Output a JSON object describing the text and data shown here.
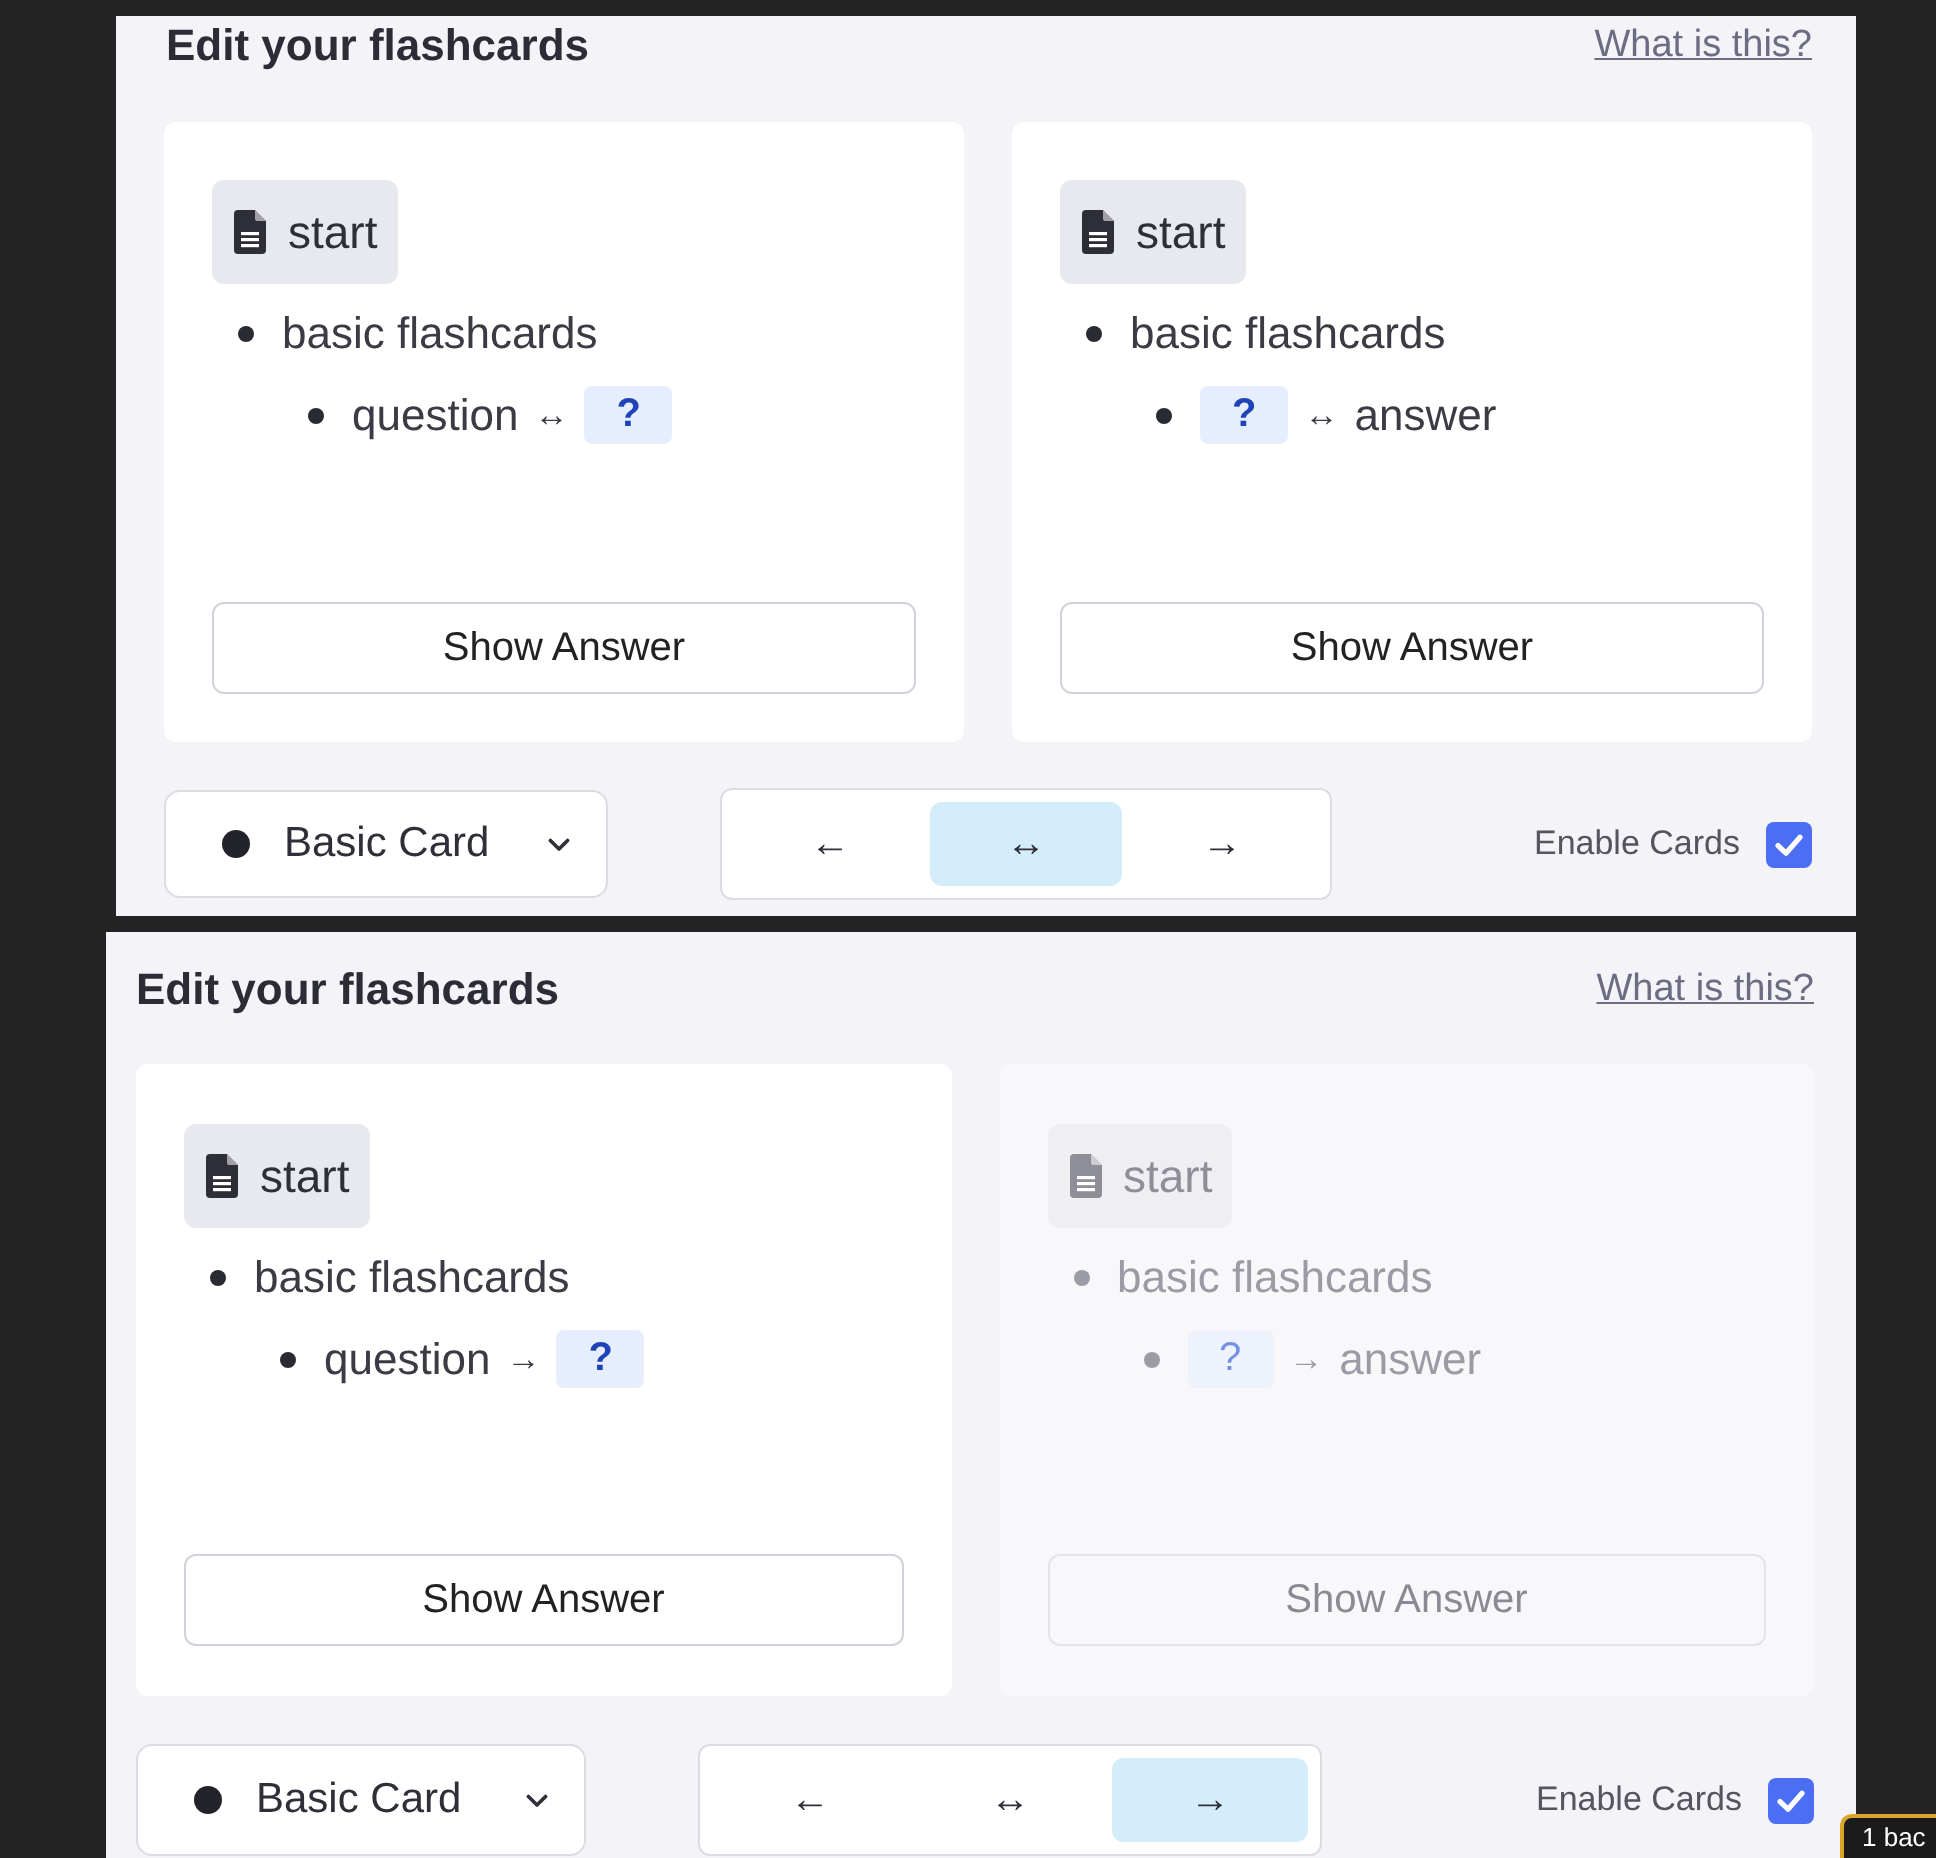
{
  "panels": [
    {
      "title": "Edit your flashcards",
      "help_link": "What is this?",
      "cards": [
        {
          "disabled": false,
          "heading": "start",
          "items": [
            {
              "parts": [
                {
                  "kind": "text",
                  "text": "basic flashcards"
                }
              ],
              "children": [
                {
                  "parts": [
                    {
                      "kind": "text",
                      "text": "question"
                    },
                    {
                      "kind": "arrow",
                      "text": "↔"
                    },
                    {
                      "kind": "blank",
                      "text": "?"
                    }
                  ]
                }
              ]
            }
          ],
          "button": "Show Answer"
        },
        {
          "disabled": false,
          "heading": "start",
          "items": [
            {
              "parts": [
                {
                  "kind": "text",
                  "text": "basic flashcards"
                }
              ],
              "children": [
                {
                  "parts": [
                    {
                      "kind": "blank",
                      "text": "?"
                    },
                    {
                      "kind": "arrow",
                      "text": "↔"
                    },
                    {
                      "kind": "text",
                      "text": "answer"
                    }
                  ]
                }
              ]
            }
          ],
          "button": "Show Answer"
        }
      ],
      "card_type": "Basic Card",
      "directions": [
        {
          "symbol": "←",
          "selected": false
        },
        {
          "symbol": "↔",
          "selected": true
        },
        {
          "symbol": "→",
          "selected": false
        }
      ],
      "enable": {
        "label": "Enable Cards",
        "checked": true
      }
    },
    {
      "title": "Edit your flashcards",
      "help_link": "What is this?",
      "cards": [
        {
          "disabled": false,
          "heading": "start",
          "items": [
            {
              "parts": [
                {
                  "kind": "text",
                  "text": "basic flashcards"
                }
              ],
              "children": [
                {
                  "parts": [
                    {
                      "kind": "text",
                      "text": "question"
                    },
                    {
                      "kind": "arrow",
                      "text": "→"
                    },
                    {
                      "kind": "blank",
                      "text": "?"
                    }
                  ]
                }
              ]
            }
          ],
          "button": "Show Answer"
        },
        {
          "disabled": true,
          "heading": "start",
          "items": [
            {
              "parts": [
                {
                  "kind": "text",
                  "text": "basic flashcards"
                }
              ],
              "children": [
                {
                  "parts": [
                    {
                      "kind": "blank",
                      "text": "?"
                    },
                    {
                      "kind": "arrow",
                      "text": "→"
                    },
                    {
                      "kind": "text",
                      "text": "answer"
                    }
                  ]
                }
              ]
            }
          ],
          "button": "Show Answer"
        }
      ],
      "card_type": "Basic Card",
      "directions": [
        {
          "symbol": "←",
          "selected": false
        },
        {
          "symbol": "↔",
          "selected": false
        },
        {
          "symbol": "→",
          "selected": true
        }
      ],
      "enable": {
        "label": "Enable Cards",
        "checked": true
      }
    }
  ],
  "status_badge": "1 bac"
}
